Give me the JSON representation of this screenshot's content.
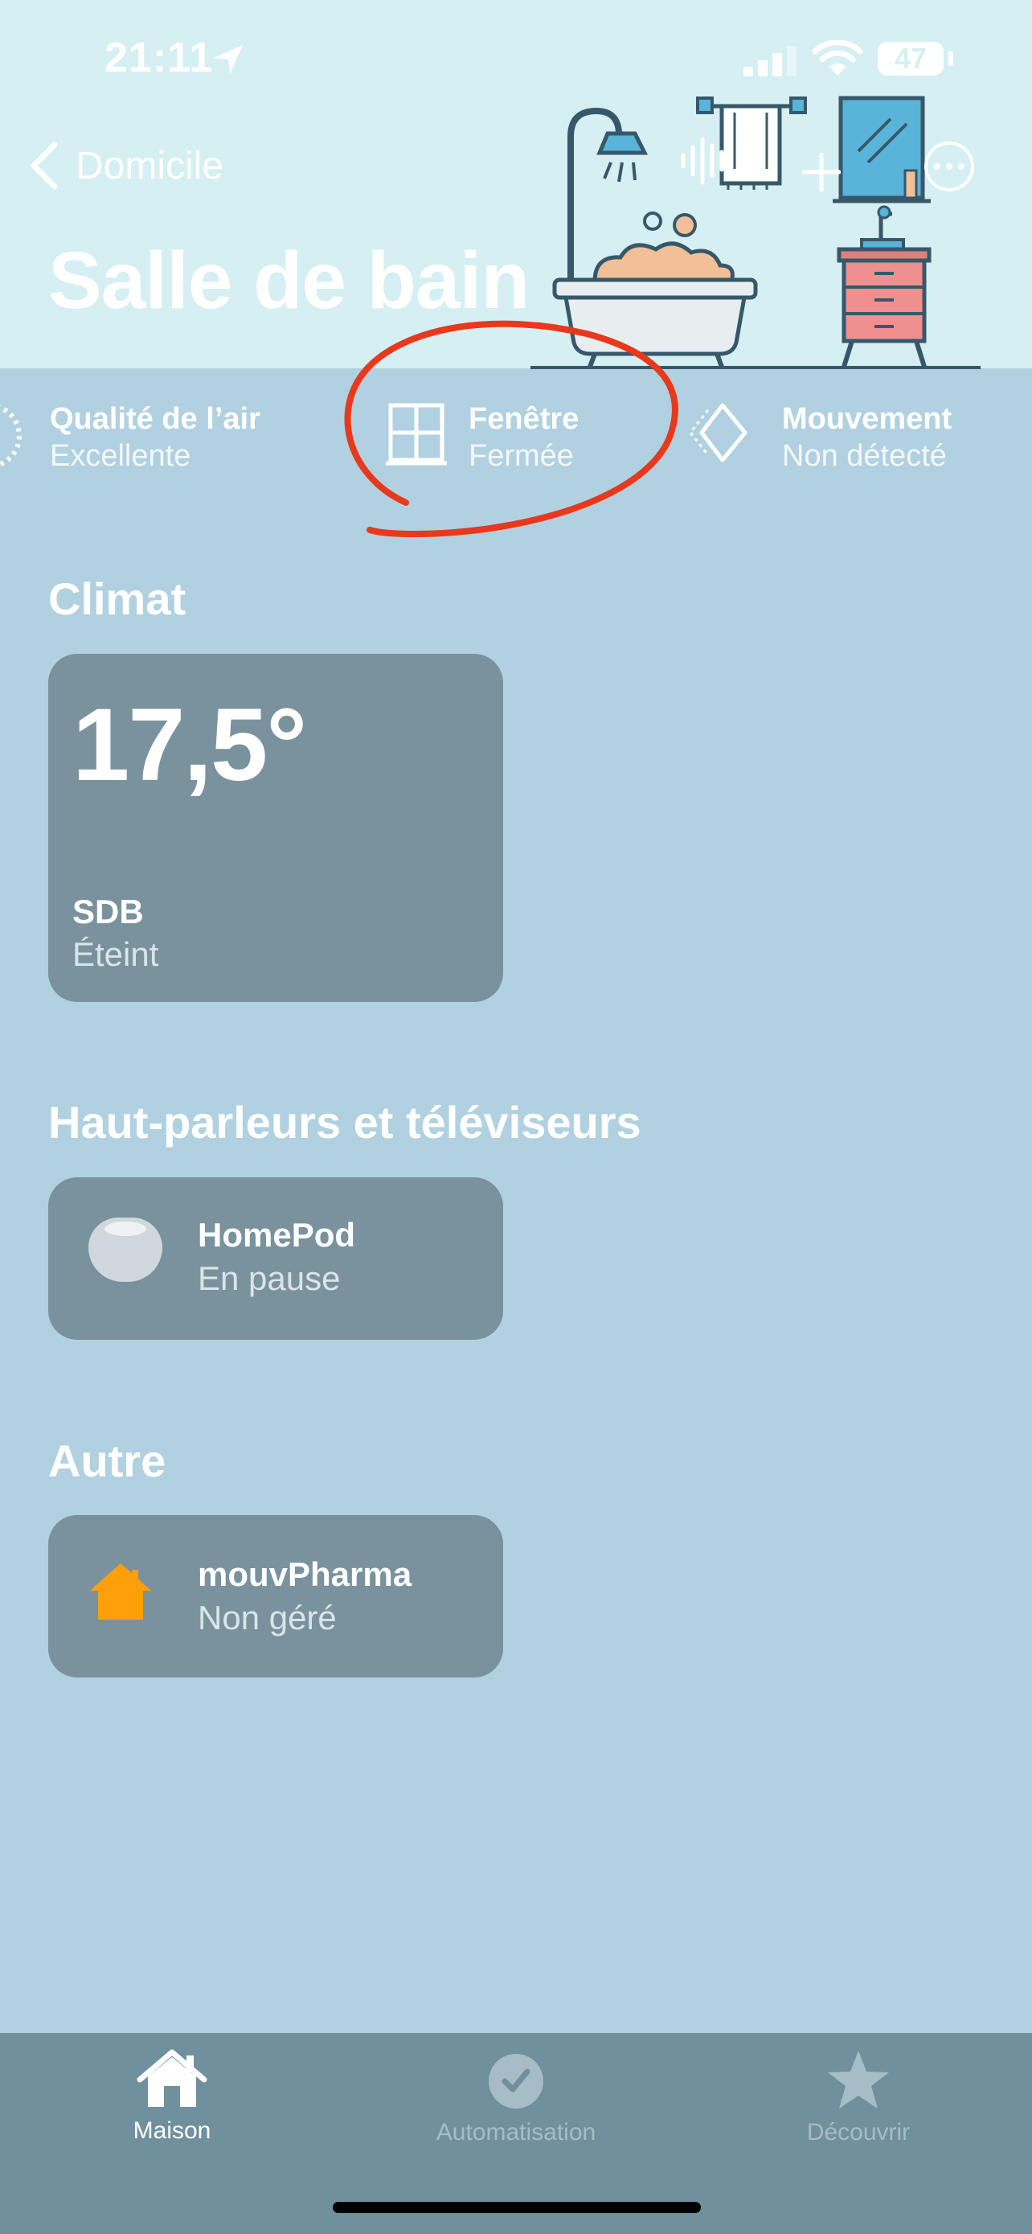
{
  "status_bar": {
    "time": "21:11",
    "battery": "47"
  },
  "nav": {
    "back_label": "Domicile",
    "title": "Salle de bain"
  },
  "room_status": [
    {
      "name": "Qualité de l’air",
      "value": "Excellente"
    },
    {
      "name": "Fenêtre",
      "value": "Fermée"
    },
    {
      "name": "Mouvement",
      "value": "Non détecté"
    }
  ],
  "sections": {
    "climate": {
      "title": "Climat",
      "tile": {
        "temperature": "17,5°",
        "name": "SDB",
        "state": "Éteint"
      }
    },
    "speakers": {
      "title": "Haut-parleurs et téléviseurs",
      "tile": {
        "name": "HomePod",
        "state": "En pause"
      }
    },
    "other": {
      "title": "Autre",
      "tile": {
        "name": "mouvPharma",
        "state": "Non géré"
      }
    }
  },
  "tabbar": {
    "tabs": [
      {
        "label": "Maison",
        "icon": "house-icon",
        "active": true
      },
      {
        "label": "Automatisation",
        "icon": "clock-check-icon",
        "active": false
      },
      {
        "label": "Découvrir",
        "icon": "star-icon",
        "active": false
      }
    ]
  },
  "colors": {
    "background": "#b1d1e1",
    "header": "#d6eff2",
    "tile": "#7a929d",
    "tabbar": "#71909e",
    "annotation": "#e8391d",
    "accessory_orange": "#ff9f0a"
  }
}
